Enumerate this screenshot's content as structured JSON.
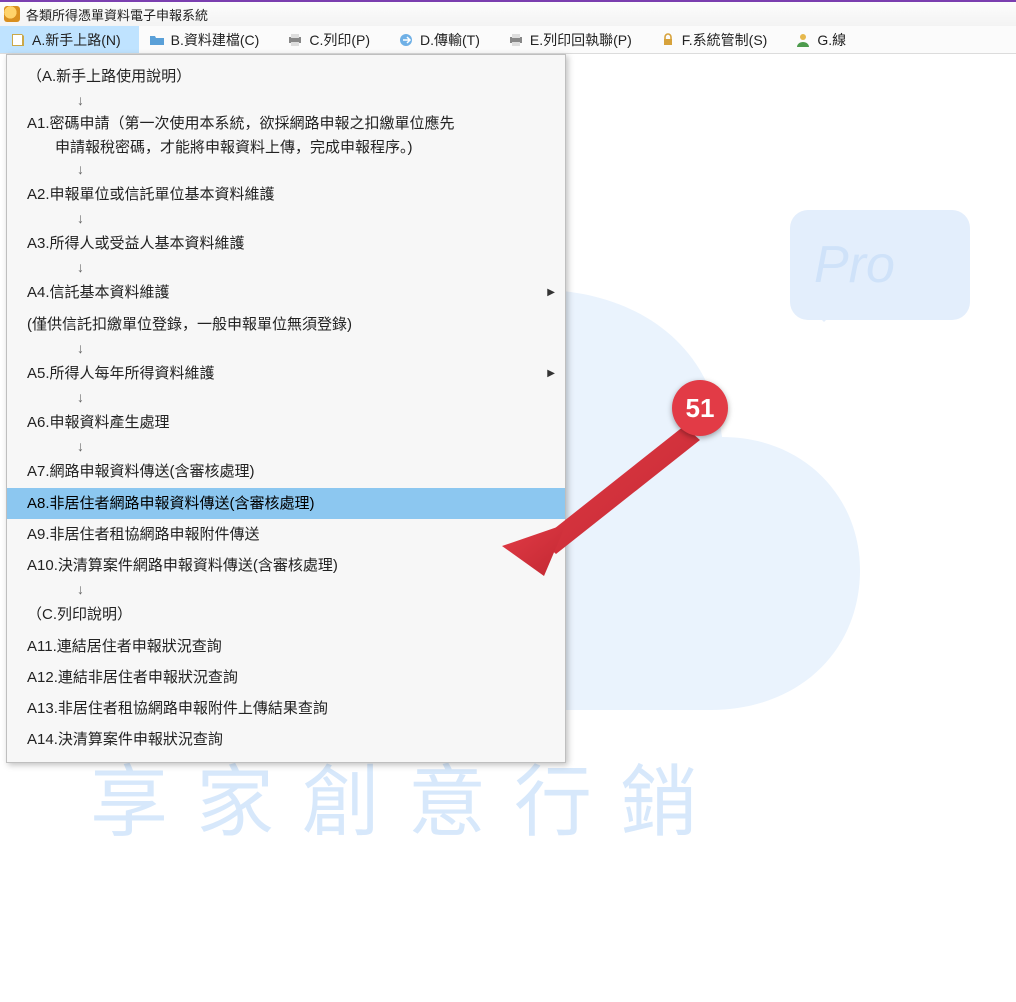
{
  "window": {
    "title": "各類所得憑單資料電子申報系統"
  },
  "menubar": {
    "items": [
      {
        "label": "A.新手上路(N)",
        "icon": "book-icon",
        "active": true
      },
      {
        "label": "B.資料建檔(C)",
        "icon": "folder-icon"
      },
      {
        "label": "C.列印(P)",
        "icon": "printer-icon"
      },
      {
        "label": "D.傳輸(T)",
        "icon": "transfer-icon"
      },
      {
        "label": "E.列印回執聯(P)",
        "icon": "printer-icon"
      },
      {
        "label": "F.系統管制(S)",
        "icon": "lock-icon"
      },
      {
        "label": "G.線",
        "icon": "user-icon"
      }
    ]
  },
  "dropdown": {
    "items": [
      {
        "kind": "text",
        "label": "（A.新手上路使用說明）"
      },
      {
        "kind": "arrow"
      },
      {
        "kind": "wrap",
        "line1": "A1.密碼申請（第一次使用本系統，欲採網路申報之扣繳單位應先",
        "line2": "申請報稅密碼，才能將申報資料上傳，完成申報程序。)"
      },
      {
        "kind": "arrow"
      },
      {
        "kind": "text",
        "label": "A2.申報單位或信託單位基本資料維護"
      },
      {
        "kind": "arrow"
      },
      {
        "kind": "text",
        "label": "A3.所得人或受益人基本資料維護"
      },
      {
        "kind": "arrow"
      },
      {
        "kind": "sub",
        "label": "A4.信託基本資料維護"
      },
      {
        "kind": "text",
        "label": "(僅供信託扣繳單位登錄，一般申報單位無須登錄)"
      },
      {
        "kind": "arrow"
      },
      {
        "kind": "sub",
        "label": "A5.所得人每年所得資料維護"
      },
      {
        "kind": "arrow"
      },
      {
        "kind": "text",
        "label": "A6.申報資料產生處理"
      },
      {
        "kind": "arrow"
      },
      {
        "kind": "text",
        "label": "A7.網路申報資料傳送(含審核處理)"
      },
      {
        "kind": "text",
        "label": "A8.非居住者網路申報資料傳送(含審核處理)",
        "selected": true
      },
      {
        "kind": "text",
        "label": "A9.非居住者租協網路申報附件傳送"
      },
      {
        "kind": "text",
        "label": "A10.決清算案件網路申報資料傳送(含審核處理)"
      },
      {
        "kind": "arrow"
      },
      {
        "kind": "text",
        "label": "（C.列印說明）"
      },
      {
        "kind": "text",
        "label": "A11.連結居住者申報狀況查詢"
      },
      {
        "kind": "text",
        "label": "A12.連結非居住者申報狀況查詢"
      },
      {
        "kind": "text",
        "label": "A13.非居住者租協網路申報附件上傳結果查詢"
      },
      {
        "kind": "text",
        "label": "A14.決清算案件申報狀況查詢"
      }
    ]
  },
  "watermark": {
    "pro": "Pro",
    "text": "享家創意行銷"
  },
  "annotation": {
    "badge": "51"
  }
}
